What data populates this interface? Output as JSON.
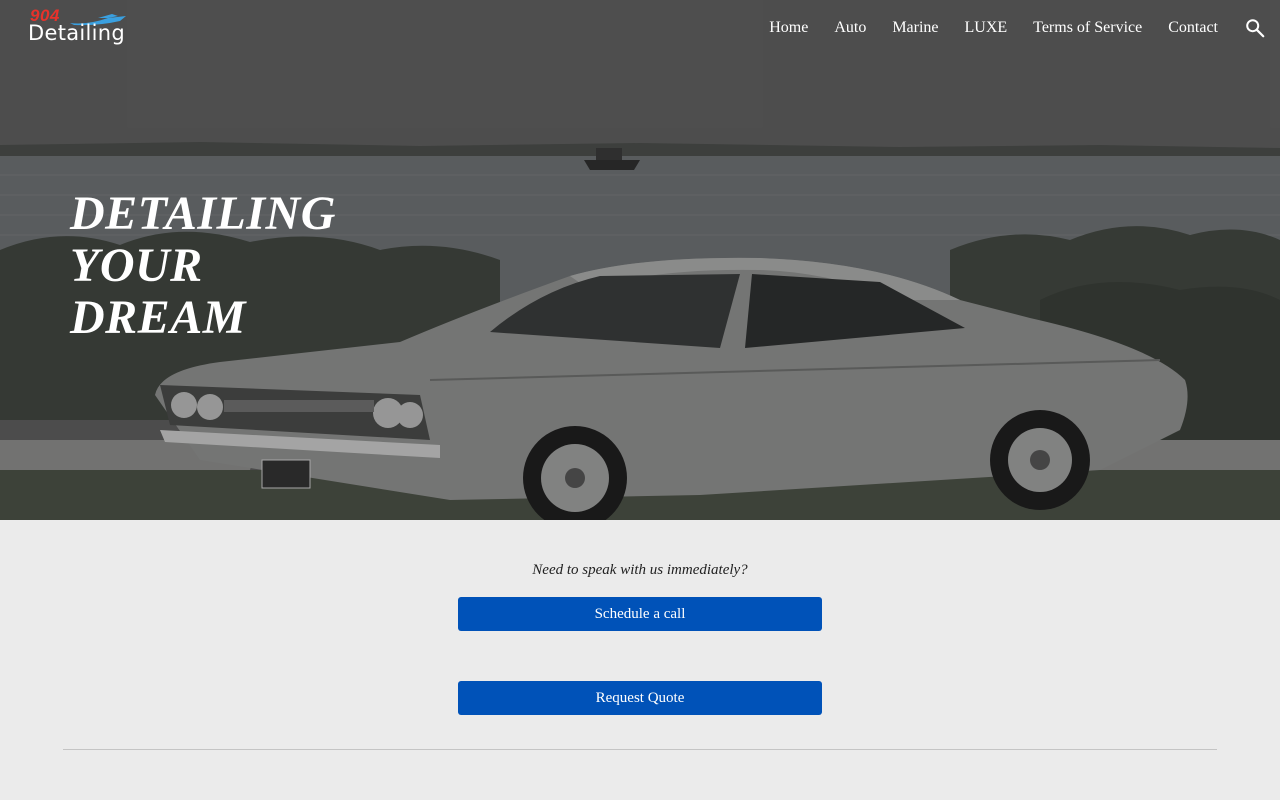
{
  "logo": {
    "number": "904",
    "word": "Detailing"
  },
  "nav": {
    "items": [
      "Home",
      "Auto",
      "Marine",
      "LUXE",
      "Terms of Service",
      "Contact"
    ],
    "search_icon": "search-icon"
  },
  "hero": {
    "title_lines": [
      "DETAILING",
      "YOUR",
      "DREAM"
    ]
  },
  "cta": {
    "prompt": "Need to speak with us immediately?",
    "schedule_label": "Schedule a call",
    "quote_label": "Request Quote"
  },
  "colors": {
    "button": "#0052b8",
    "logo_red": "#e8322b",
    "logo_blue": "#3aa0e0",
    "background": "#ebebeb"
  }
}
